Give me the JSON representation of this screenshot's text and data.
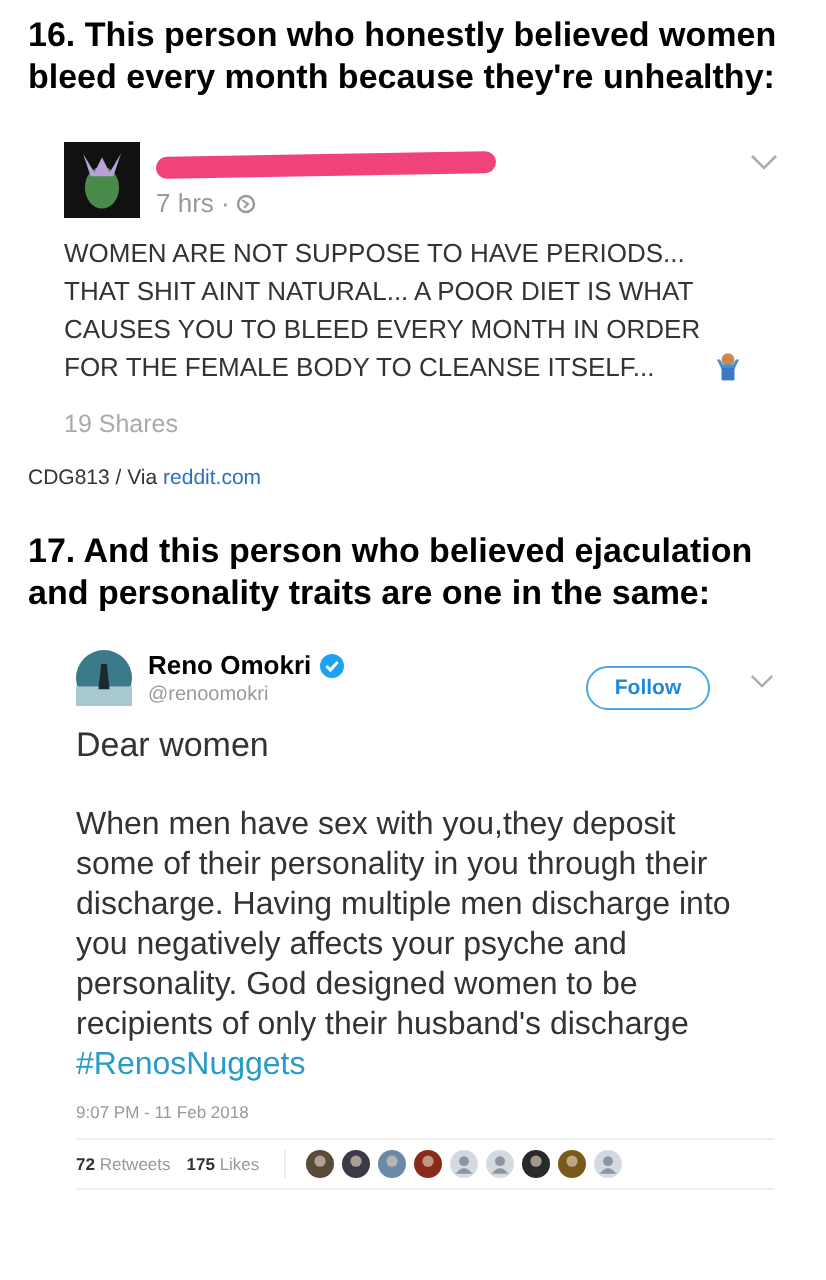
{
  "items": [
    {
      "heading": "16. This person who honestly believed women bleed every month because they're unhealthy:",
      "post": {
        "kind": "facebook",
        "time": "7 hrs ·",
        "text": "WOMEN ARE NOT SUPPOSE TO HAVE PERIODS... THAT SHIT AINT NATURAL... A POOR DIET IS WHAT CAUSES YOU TO BLEED EVERY MONTH IN ORDER FOR THE FEMALE BODY TO CLEANSE ITSELF...",
        "shares": "19 Shares"
      },
      "credit": {
        "source": "CDG813 / Via",
        "link": "reddit.com"
      }
    },
    {
      "heading": "17. And this person who believed ejaculation and personality traits are one in the same:",
      "post": {
        "kind": "twitter",
        "name": "Reno Omokri",
        "verified": true,
        "handle": "@renoomokri",
        "follow": "Follow",
        "greeting": "Dear women",
        "text": "When men have sex with you,they deposit some of their personality in you through their discharge. Having multiple men discharge into you negatively affects your psyche and personality. God designed women to be recipients of only their husband's discharge",
        "hashtag": "#RenosNuggets",
        "time": "9:07 PM - 11 Feb 2018",
        "retweets": "**72** Retweets",
        "likes": "**175** Likes",
        "likers": [
          {
            "kind": "photo",
            "color": "#5a4a3a"
          },
          {
            "kind": "photo",
            "color": "#3a3a48"
          },
          {
            "kind": "photo",
            "color": "#6a8aa8"
          },
          {
            "kind": "photo",
            "color": "#8a2a1a"
          },
          {
            "kind": "default"
          },
          {
            "kind": "default"
          },
          {
            "kind": "photo",
            "color": "#2a2a2a"
          },
          {
            "kind": "photo",
            "color": "#7a5a1a"
          },
          {
            "kind": "default"
          }
        ]
      }
    }
  ]
}
